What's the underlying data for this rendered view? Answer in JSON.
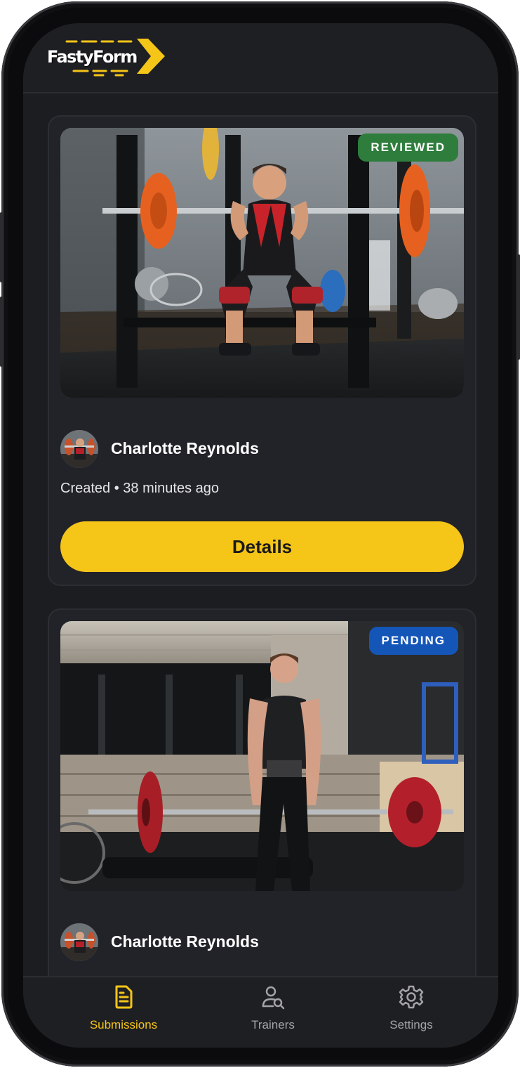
{
  "app": {
    "logo_text": "FastyForm"
  },
  "colors": {
    "accent": "#f5c518",
    "background": "#1c1d21",
    "card": "#222328",
    "reviewed": "#2e7d3c",
    "pending": "#1456b8"
  },
  "submissions": [
    {
      "status": "REVIEWED",
      "status_color": "#2e7d3c",
      "photo": "barbell-squat-photo",
      "author": "Charlotte Reynolds",
      "meta": "Created • 38 minutes ago",
      "button": "Details"
    },
    {
      "status": "PENDING",
      "status_color": "#1456b8",
      "photo": "deadlift-photo",
      "author": "Charlotte Reynolds"
    }
  ],
  "tabbar": {
    "tabs": [
      {
        "label": "Submissions",
        "icon": "document-icon",
        "active": true
      },
      {
        "label": "Trainers",
        "icon": "user-search-icon",
        "active": false
      },
      {
        "label": "Settings",
        "icon": "gear-icon",
        "active": false
      }
    ]
  }
}
